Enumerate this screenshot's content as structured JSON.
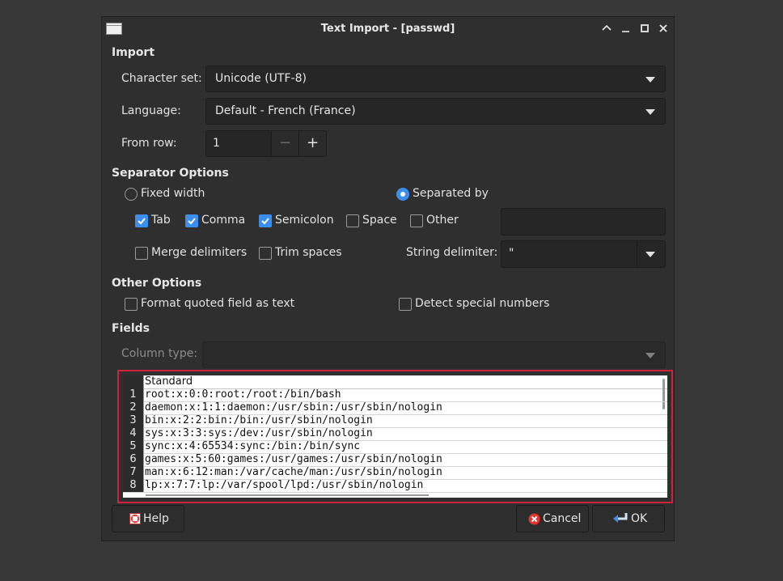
{
  "window": {
    "title": "Text Import - [passwd]"
  },
  "import": {
    "heading": "Import",
    "charset_label": "Character set:",
    "charset_value": "Unicode (UTF-8)",
    "language_label": "Language:",
    "language_value": "Default - French (France)",
    "from_row_label": "From row:",
    "from_row_value": "1",
    "minus": "−",
    "plus": "+"
  },
  "separator": {
    "heading": "Separator Options",
    "fixed_width": "Fixed width",
    "separated_by": "Separated by",
    "tab": "Tab",
    "comma": "Comma",
    "semicolon": "Semicolon",
    "space": "Space",
    "other": "Other",
    "merge_delimiters": "Merge delimiters",
    "trim_spaces": "Trim spaces",
    "string_delimiter_label": "String delimiter:",
    "string_delimiter_value": "\""
  },
  "other_options": {
    "heading": "Other Options",
    "format_quoted": "Format quoted field as text",
    "detect_special": "Detect special numbers"
  },
  "fields": {
    "heading": "Fields",
    "column_type_label": "Column type:",
    "column_header": "Standard",
    "rows": [
      {
        "n": "1",
        "text": "root:x:0:0:root:/root:/bin/bash"
      },
      {
        "n": "2",
        "text": "daemon:x:1:1:daemon:/usr/sbin:/usr/sbin/nologin"
      },
      {
        "n": "3",
        "text": "bin:x:2:2:bin:/bin:/usr/sbin/nologin"
      },
      {
        "n": "4",
        "text": "sys:x:3:3:sys:/dev:/usr/sbin/nologin"
      },
      {
        "n": "5",
        "text": "sync:x:4:65534:sync:/bin:/bin/sync"
      },
      {
        "n": "6",
        "text": "games:x:5:60:games:/usr/games:/usr/sbin/nologin"
      },
      {
        "n": "7",
        "text": "man:x:6:12:man:/var/cache/man:/usr/sbin/nologin"
      },
      {
        "n": "8",
        "text": "lp:x:7:7:lp:/var/spool/lpd:/usr/sbin/nologin"
      }
    ]
  },
  "buttons": {
    "help": "Help",
    "cancel": "Cancel",
    "ok": "OK"
  },
  "colors": {
    "accent": "#3b8eed",
    "highlight_border": "#d2213e",
    "cancel_icon": "#e5342f"
  }
}
